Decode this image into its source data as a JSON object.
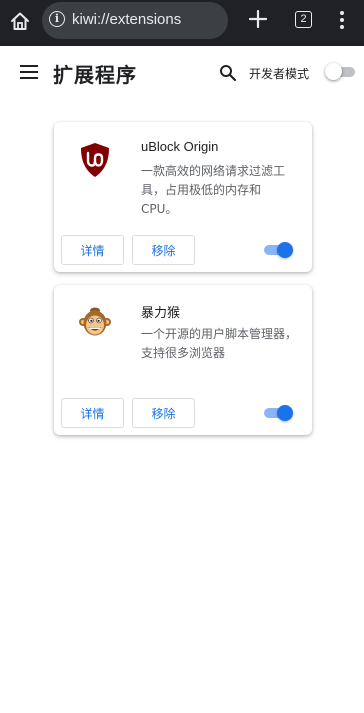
{
  "browser": {
    "url": "kiwi://extensions",
    "tab_count": "2"
  },
  "header": {
    "title": "扩展程序",
    "developer_mode_label": "开发者模式",
    "developer_mode_on": false
  },
  "extensions": [
    {
      "name": "uBlock Origin",
      "description": "一款高效的网络请求过滤工具，占用极低的内存和CPU。",
      "details_label": "详情",
      "remove_label": "移除",
      "enabled": true,
      "icon": "ublock-origin-icon"
    },
    {
      "name": "暴力猴",
      "description": "一个开源的用户脚本管理器，支持很多浏览器",
      "details_label": "详情",
      "remove_label": "移除",
      "enabled": true,
      "icon": "violentmonkey-icon"
    }
  ],
  "colors": {
    "accent": "#1a73e8",
    "topbar": "#202124",
    "ublock_red": "#800000"
  }
}
